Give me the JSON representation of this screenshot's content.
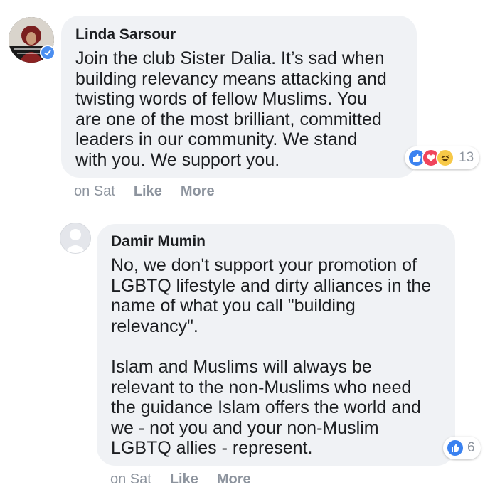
{
  "comments": [
    {
      "author": "Linda Sarsour",
      "text": "Join the club Sister Dalia. It’s sad when\nbuilding relevancy means attacking and\ntwisting words of fellow Muslims. You\nare one of the most brilliant, committed\nleaders in our community. We stand\nwith you. We support you.",
      "reaction_count": "13",
      "reaction_icons": [
        "like-icon",
        "love-icon",
        "haha-icon"
      ],
      "time": "on Sat",
      "like_label": "Like",
      "more_label": "More",
      "verified": true
    },
    {
      "author": "Damir Mumin",
      "text": "No, we don't support your promotion of\nLGBTQ lifestyle and dirty alliances in the\nname of what you call \"building\nrelevancy\".\n\nIslam and Muslims will always be\nrelevant to the non-Muslims who need\nthe guidance Islam offers the world and\nwe - not you and your non-Muslim\nLGBTQ allies - represent.",
      "reaction_count": "6",
      "reaction_icons": [
        "like-icon"
      ],
      "time": "on Sat",
      "like_label": "Like",
      "more_label": "More"
    }
  ],
  "colors": {
    "bubble": "#f0f2f5",
    "meta_text": "#8d949e",
    "like_blue": "#3b82f0",
    "love_red": "#f0455c",
    "haha_yellow": "#f7c948"
  }
}
